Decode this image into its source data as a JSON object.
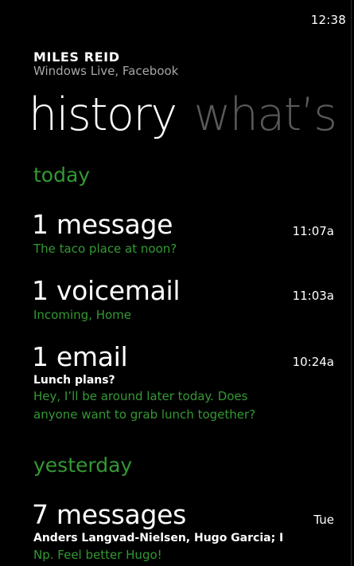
{
  "status_bar": {
    "time": "12:38"
  },
  "contact": {
    "name": "MILES REID",
    "sources": "Windows Live, Facebook"
  },
  "pivot": {
    "tabs": [
      {
        "label": "history",
        "active": true
      },
      {
        "label": "what’s ne",
        "active": false
      }
    ]
  },
  "colors": {
    "accent": "#339933",
    "background": "#000000",
    "text_primary": "#ffffff",
    "text_secondary": "#a6a6a6",
    "pivot_inactive": "#5a5a5a"
  },
  "groups": [
    {
      "label": "today",
      "items": [
        {
          "title": "1 message",
          "time": "11:07a",
          "subtitle": "The taco place at noon?"
        },
        {
          "title": "1 voicemail",
          "time": "11:03a",
          "subtitle": "Incoming, Home"
        },
        {
          "title": "1 email",
          "time": "10:24a",
          "bold_line": "Lunch plans?",
          "body_line1": "Hey, I’ll be around later today. Does",
          "body_line2": "anyone want to grab lunch together?"
        }
      ]
    },
    {
      "label": "yesterday",
      "items": [
        {
          "title": "7 messages",
          "time": "Tue",
          "bold_line": "Anders Langvad-Nielsen, Hugo Garcia; I",
          "subtitle": "Np. Feel better Hugo!"
        }
      ]
    }
  ]
}
